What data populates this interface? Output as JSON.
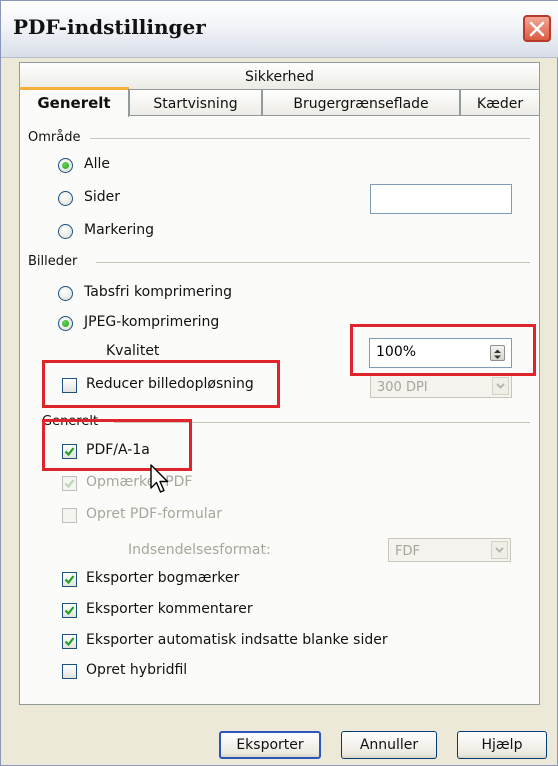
{
  "window": {
    "title": "PDF-indstillinger"
  },
  "tabs": {
    "row_back": [
      "Sikkerhed"
    ],
    "row_front": [
      "Generelt",
      "Startvisning",
      "Brugergrænseflade",
      "Kæder"
    ],
    "active": "Generelt"
  },
  "omraade": {
    "title": "Område",
    "options": [
      "Alle",
      "Sider",
      "Markering"
    ],
    "selected": "Alle",
    "pages_value": ""
  },
  "billeder": {
    "title": "Billeder",
    "options": [
      "Tabsfri komprimering",
      "JPEG-komprimering"
    ],
    "selected": "JPEG-komprimering",
    "quality_label": "Kvalitet",
    "quality_value": "100%",
    "reduce_label": "Reducer billedopløsning",
    "reduce_checked": false,
    "dpi_value": "300 DPI"
  },
  "generelt": {
    "title": "Generelt",
    "pdfa": {
      "label": "PDF/A-1a",
      "checked": true
    },
    "tagged": {
      "label": "Opmærket PDF",
      "checked": true,
      "disabled": true
    },
    "form": {
      "label": "Opret PDF-formular",
      "checked": false,
      "disabled": true
    },
    "submit_label": "Indsendelsesformat:",
    "submit_value": "FDF",
    "bookmarks": {
      "label": "Eksporter bogmærker",
      "checked": true
    },
    "comments": {
      "label": "Eksporter kommentarer",
      "checked": true
    },
    "blank_pages": {
      "label": "Eksporter automatisk indsatte blanke sider",
      "checked": true
    },
    "hybrid": {
      "label": "Opret hybridfil",
      "checked": false
    }
  },
  "buttons": {
    "export": "Eksporter",
    "cancel": "Annuller",
    "help": "Hjælp"
  },
  "colors": {
    "highlight": "#e0242b",
    "tab_accent": "#f6b13c",
    "check_green": "#21a121"
  },
  "icons": {
    "close": "close-icon",
    "cursor": "mouse-cursor-icon"
  }
}
